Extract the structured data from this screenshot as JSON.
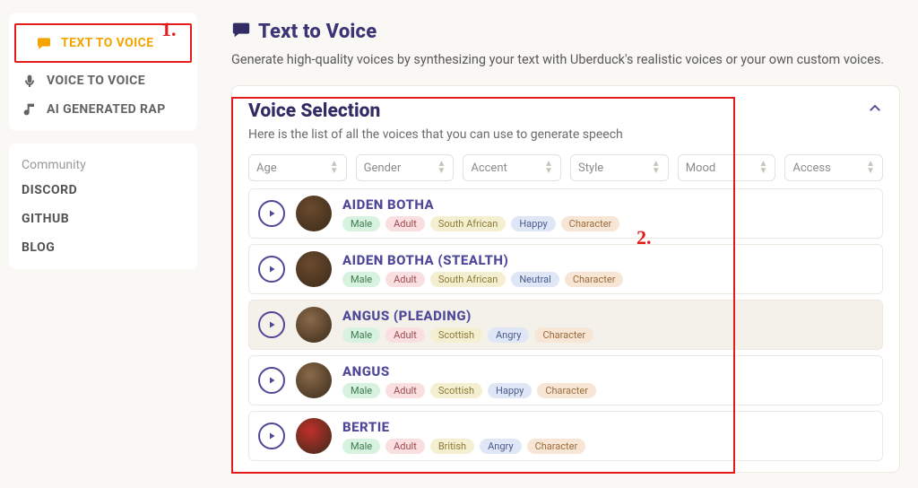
{
  "sidebar": {
    "nav": [
      {
        "label": "TEXT TO VOICE",
        "icon": "chat-icon",
        "active": true
      },
      {
        "label": "VOICE TO VOICE",
        "icon": "mic-icon",
        "active": false
      },
      {
        "label": "AI GENERATED RAP",
        "icon": "music-icon",
        "active": false
      }
    ],
    "community_heading": "Community",
    "community": [
      "DISCORD",
      "GITHUB",
      "BLOG"
    ]
  },
  "header": {
    "title": "Text to Voice",
    "subtitle": "Generate high-quality voices by synthesizing your text with Uberduck's realistic voices or your own custom voices."
  },
  "panel": {
    "title": "Voice Selection",
    "subtitle": "Here is the list of all the voices that you can use to generate speech",
    "filters": [
      "Age",
      "Gender",
      "Accent",
      "Style",
      "Mood",
      "Access"
    ]
  },
  "voices": [
    {
      "name": "AIDEN BOTHA",
      "avatar": "#6b4a2e",
      "tags": [
        [
          "Male",
          "gender"
        ],
        [
          "Adult",
          "age"
        ],
        [
          "South African",
          "accent"
        ],
        [
          "Happy",
          "style"
        ],
        [
          "Character",
          "char"
        ]
      ],
      "selected": false
    },
    {
      "name": "AIDEN BOTHA (STEALTH)",
      "avatar": "#6b4a2e",
      "tags": [
        [
          "Male",
          "gender"
        ],
        [
          "Adult",
          "age"
        ],
        [
          "South African",
          "accent"
        ],
        [
          "Neutral",
          "style"
        ],
        [
          "Character",
          "char"
        ]
      ],
      "selected": false
    },
    {
      "name": "ANGUS (PLEADING)",
      "avatar": "#8a6a4a",
      "tags": [
        [
          "Male",
          "gender"
        ],
        [
          "Adult",
          "age"
        ],
        [
          "Scottish",
          "accent"
        ],
        [
          "Angry",
          "style"
        ],
        [
          "Character",
          "char"
        ]
      ],
      "selected": true
    },
    {
      "name": "ANGUS",
      "avatar": "#8a6a4a",
      "tags": [
        [
          "Male",
          "gender"
        ],
        [
          "Adult",
          "age"
        ],
        [
          "Scottish",
          "accent"
        ],
        [
          "Happy",
          "style"
        ],
        [
          "Character",
          "char"
        ]
      ],
      "selected": false
    },
    {
      "name": "BERTIE",
      "avatar": "#c0302a",
      "tags": [
        [
          "Male",
          "gender"
        ],
        [
          "Adult",
          "age"
        ],
        [
          "British",
          "accent"
        ],
        [
          "Angry",
          "style"
        ],
        [
          "Character",
          "char"
        ]
      ],
      "selected": false
    }
  ],
  "annotations": {
    "one": "1.",
    "two": "2."
  }
}
